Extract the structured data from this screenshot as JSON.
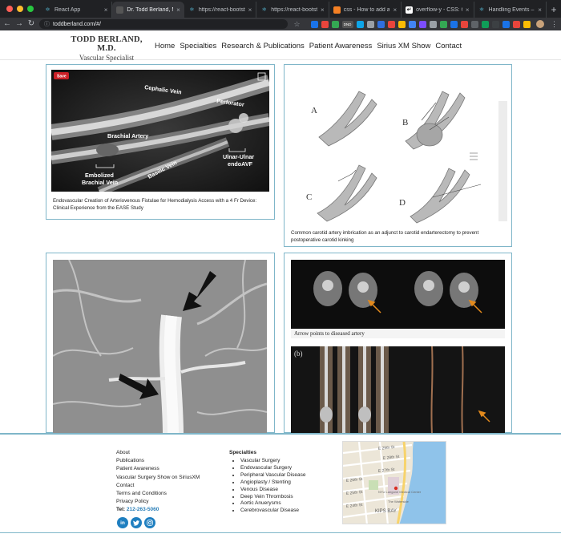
{
  "browser": {
    "tabs": [
      {
        "label": "React App",
        "active": false
      },
      {
        "label": "Dr. Todd Berland, MD",
        "active": true
      },
      {
        "label": "https://react-bootstrap",
        "active": false
      },
      {
        "label": "https://react-bootstra",
        "active": false
      },
      {
        "label": "css - How to add a s",
        "active": false
      },
      {
        "label": "overflow-y - CSS: Ca",
        "active": false
      },
      {
        "label": "Handling Events – Re",
        "active": false
      }
    ],
    "url": "toddberland.com/#/",
    "new_tab": "+",
    "ext_badge": "DND"
  },
  "site": {
    "brand_name": "TODD BERLAND, M.D.",
    "brand_sub": "Vascular Specialist",
    "nav": [
      "Home",
      "Specialties",
      "Research & Publications",
      "Patient Awareness",
      "Sirius XM Show",
      "Contact"
    ]
  },
  "gallery": {
    "card1": {
      "save_label": "Save",
      "labels": {
        "cephalic": "Cephalic Vein",
        "perforator": "Perforator",
        "brachial_artery": "Brachial Artery",
        "ulnar": "Ulnar-Ulnar",
        "endoavf": "endoAVF",
        "embolized": "Embolized",
        "brachial_vein": "Brachial Vein",
        "basilic": "Basilic Vein"
      },
      "caption": "Endovascular Creation of Arteriovenous Fistulae for Hemodialysis Access with a 4 Fr Device: Clinical Experience from the EASE Study"
    },
    "card2": {
      "panel_letters": [
        "A",
        "B",
        "C",
        "D"
      ],
      "caption": "Common carotid artery imbrication as an adjunct to carotid endarterectomy to prevent postoperative carotid kinking"
    },
    "card4": {
      "annotation": "Arrow points to diseased artery",
      "panel_b": "(b)"
    }
  },
  "footer": {
    "links": [
      "About",
      "Publications",
      "Patient Awareness",
      "Vascular Surgery Show on SiriusXM",
      "Contact",
      "Terms and Conditions",
      "Privacy Policy"
    ],
    "phone_label": "Tel:",
    "phone": "212-263-5060",
    "socials": [
      "in",
      "t",
      "ig"
    ],
    "specialties_title": "Specialties",
    "specialties": [
      "Vascular Surgery",
      "Endovascular Surgery",
      "Peripheral Vascular Disease",
      "Angioplasty / Stenting",
      "Venous Disease",
      "Deep Vein Thrombosis",
      "Aortic Anuerysms",
      "Cerebrovascular Disease"
    ],
    "map": {
      "labels": [
        "E 29th St",
        "E 28th St",
        "E 27th St",
        "E 26th St",
        "E 25th St",
        "E 24th St",
        "KIPS BAY",
        "NYU Langone Medical Center",
        "The Waterside"
      ]
    }
  },
  "colors": {
    "accent": "#7fb6c9",
    "phone": "#2a7fb8",
    "social": "#1f7fc0",
    "chrome_dark": "#202124",
    "chrome_mid": "#35363a"
  }
}
